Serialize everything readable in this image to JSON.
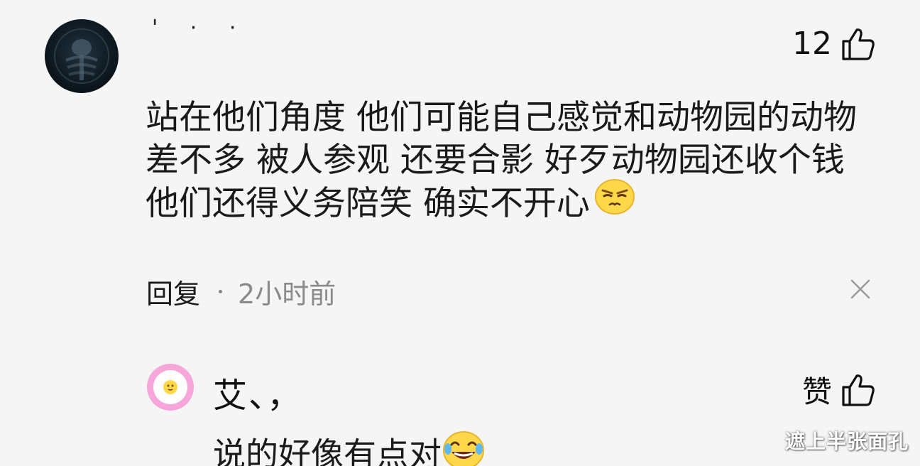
{
  "comment": {
    "username": "' · ·",
    "like_count": "12",
    "text_lines": [
      "站在他们角度 他们可能自己感觉和动物园的动物",
      "差不多 被人参观 还要合影 好歹动物园还收个钱",
      "他们还得义务陪笑 确实不开心"
    ],
    "emoji": "annoyed-face-emoji",
    "reply_label": "回复",
    "timestamp": "2小时前"
  },
  "reply": {
    "username": "艾、，",
    "like_label": "赞",
    "text": "说的好像有点对",
    "emoji": "laughing-crying-emoji"
  },
  "watermark": "遮上半张面孔",
  "icons": [
    "thumbs-up-icon",
    "close-icon",
    "avatar-image"
  ],
  "colors": {
    "background": "#f5f5f5",
    "text": "#1a1a1a",
    "muted": "#8a8a8a",
    "reply_avatar_ring": "#f6a6d9"
  }
}
